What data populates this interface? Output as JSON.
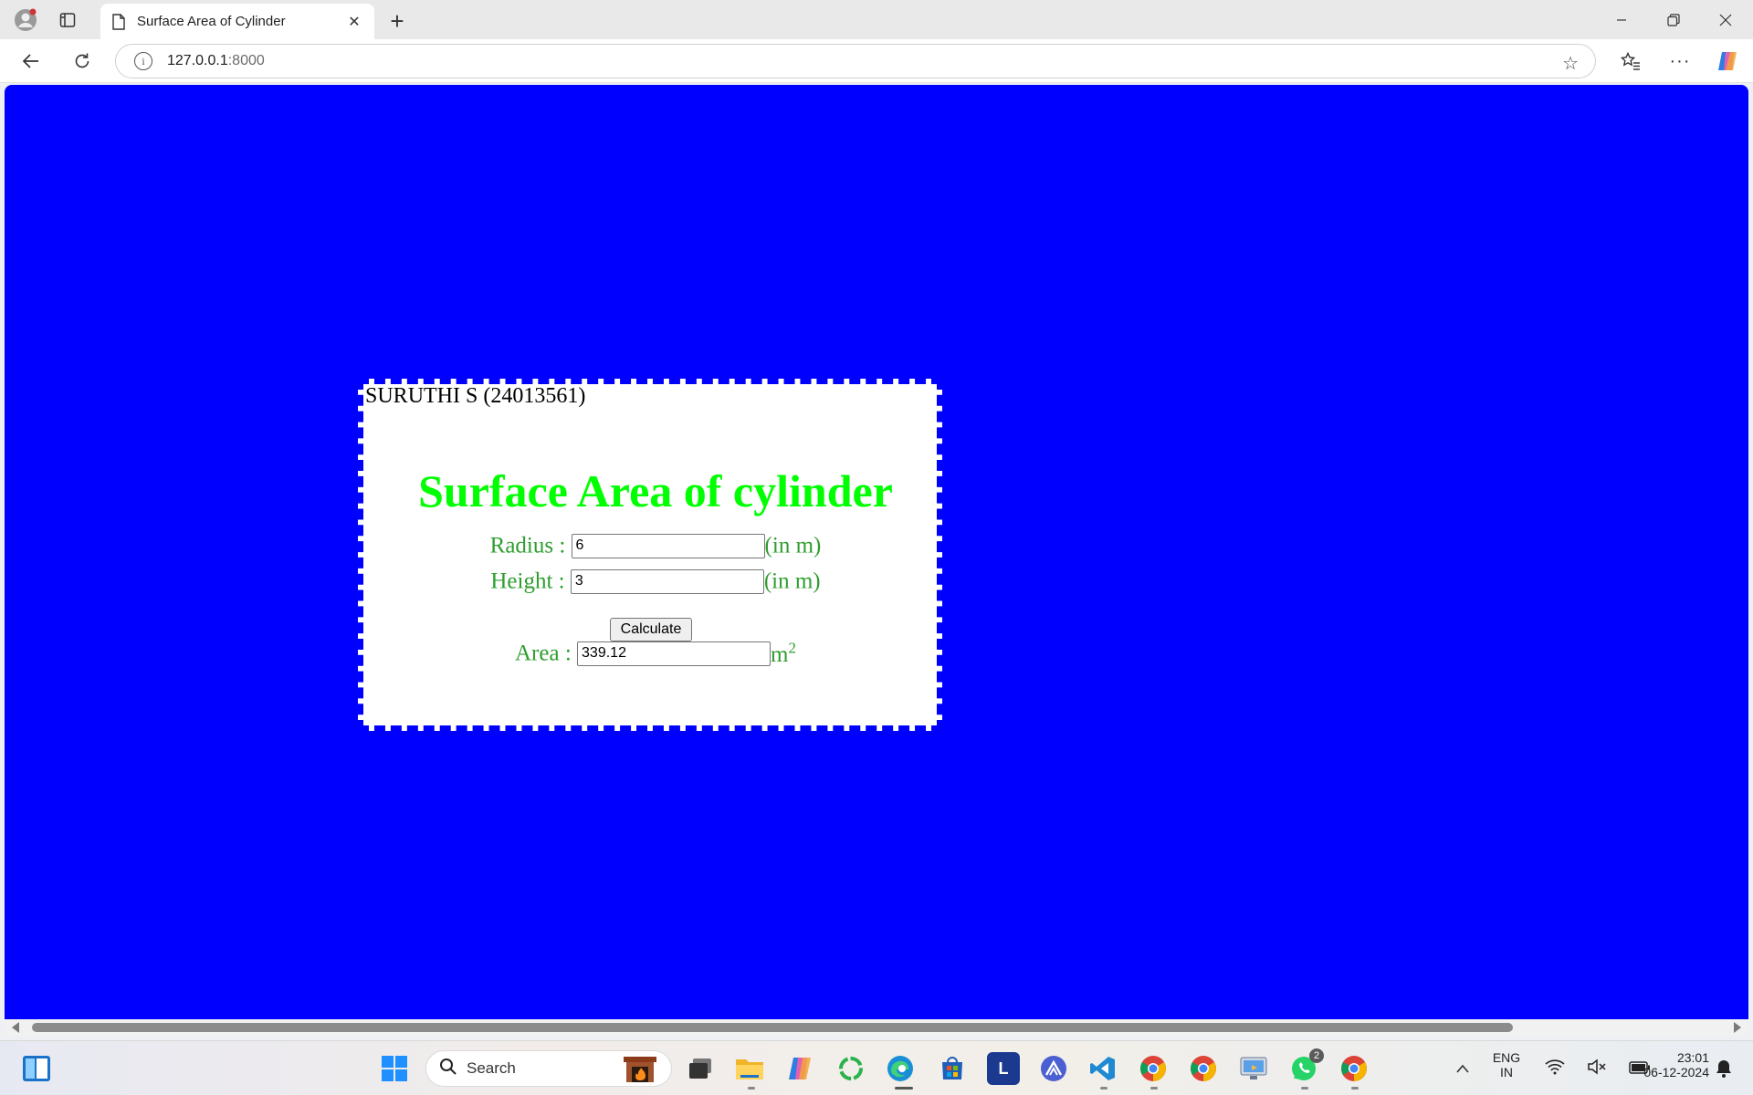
{
  "browser": {
    "tab_title": "Surface Area of Cylinder",
    "address_host": "127.0.0.1",
    "address_port": ":8000"
  },
  "page": {
    "author": "SURUTHI S (24013561)",
    "heading": "Surface Area of cylinder",
    "radius_label": "Radius :",
    "radius_value": "6",
    "radius_unit": "(in m)",
    "height_label": "Height :",
    "height_value": "3",
    "height_unit": "(in m)",
    "calculate_label": "Calculate",
    "area_label": "Area :",
    "area_value": "339.12",
    "area_unit_base": "m",
    "area_unit_exp": "2",
    "colors": {
      "background": "#0000ff",
      "heading": "#00ff00",
      "labels": "#2e9e2e"
    }
  },
  "taskbar": {
    "search_label": "Search",
    "lang_top": "ENG",
    "lang_bottom": "IN",
    "time": "23:01",
    "date": "06-12-2024",
    "whatsapp_badge": "2",
    "icons": [
      "start-icon",
      "search-icon",
      "fireplace-widget-icon",
      "task-view-icon",
      "file-explorer-icon",
      "copilot-icon",
      "refresh-app-icon",
      "edge-icon",
      "store-icon",
      "l-app-icon",
      "arc-app-icon",
      "vscode-icon",
      "chrome-icon",
      "chrome-icon",
      "remote-desktop-icon",
      "whatsapp-icon",
      "chrome-icon"
    ]
  }
}
